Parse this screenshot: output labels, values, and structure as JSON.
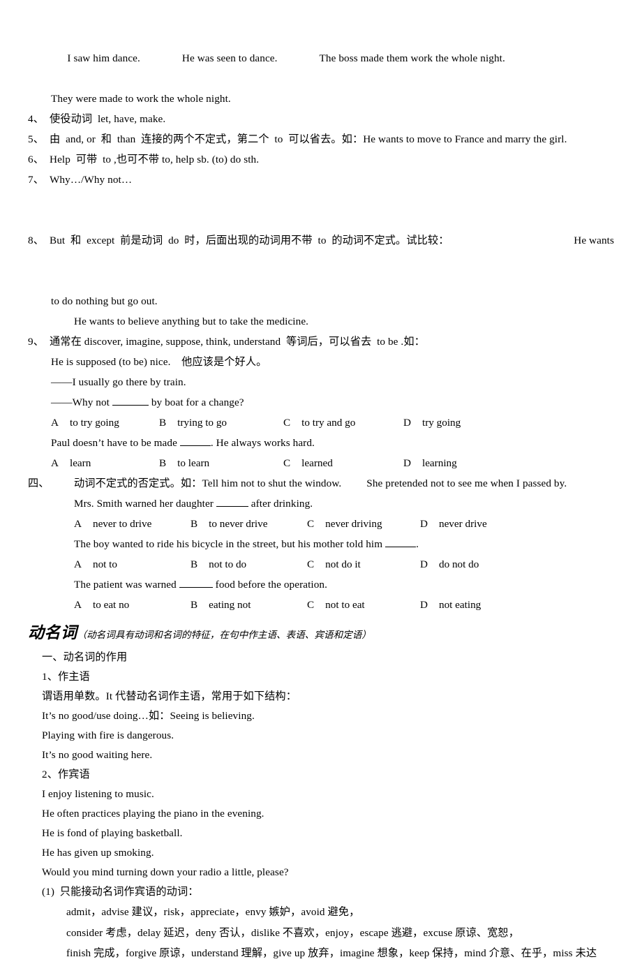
{
  "document": {
    "section_infinitive": {
      "examples_top": {
        "line1_a": "I saw him dance.",
        "line1_b": "He was seen to dance.",
        "line1_c": "The boss made them work the whole night.",
        "line2": "They were made to work the whole night."
      },
      "items": [
        {
          "num": "4、",
          "text": "使役动词  let, have, make."
        },
        {
          "num": "5、",
          "text": "由  and, or  和  than  连接的两个不定式，第二个  to  可以省去。如：He wants to move to France and marry the girl."
        },
        {
          "num": "6、",
          "text": "Help  可带  to ,也可不带 to, help sb. (to) do sth."
        },
        {
          "num": "7、",
          "text": "Why…/Why not…"
        },
        {
          "num": "8、",
          "text": "But  和  except  前是动词  do  时，后面出现的动词用不带  to  的动词不定式。试比较：",
          "tail": "He wants",
          "cont1": "to do nothing but go out.",
          "cont2": "He wants to believe anything but to take the medicine."
        },
        {
          "num": "9、",
          "text": "通常在 discover, imagine, suppose, think, understand  等词后，可以省去  to be .如：",
          "cont1": "He is supposed (to be) nice.    他应该是个好人。"
        }
      ],
      "dialogue": {
        "line_a": "——I usually go there by train.",
        "line_b_pre": "——Why not",
        "line_b_post": "by boat for a change?"
      },
      "question1_options": [
        {
          "letter": "A",
          "text": "to try going"
        },
        {
          "letter": "B",
          "text": "trying to go"
        },
        {
          "letter": "C",
          "text": "to try and go"
        },
        {
          "letter": "D",
          "text": "try going"
        }
      ],
      "question2_stem_pre": "Paul doesn’t have to be made",
      "question2_stem_post": ". He always works hard.",
      "question2_options": [
        {
          "letter": "A",
          "text": "learn"
        },
        {
          "letter": "B",
          "text": "to learn"
        },
        {
          "letter": "C",
          "text": "learned"
        },
        {
          "letter": "D",
          "text": "learning"
        }
      ]
    },
    "section_four": {
      "num": "四、",
      "title": "动词不定式的否定式。如：Tell him not to shut the window.",
      "title_extra": "She pretended not to see me when I passed by.",
      "q1_pre": "Mrs. Smith warned her daughter",
      "q1_post": "after drinking.",
      "q1_options": [
        {
          "letter": "A",
          "text": "never to drive"
        },
        {
          "letter": "B",
          "text": "to never drive"
        },
        {
          "letter": "C",
          "text": "never driving"
        },
        {
          "letter": "D",
          "text": "never drive"
        }
      ],
      "q2_pre": "The boy wanted to ride his bicycle in the street, but his mother told him",
      "q2_post": ".",
      "q2_options": [
        {
          "letter": "A",
          "text": "not to"
        },
        {
          "letter": "B",
          "text": "not to do"
        },
        {
          "letter": "C",
          "text": "not do it"
        },
        {
          "letter": "D",
          "text": "do not do"
        }
      ],
      "q3_pre": "The patient was warned",
      "q3_post": "food before the operation.",
      "q3_options": [
        {
          "letter": "A",
          "text": "to eat no"
        },
        {
          "letter": "B",
          "text": "eating not"
        },
        {
          "letter": "C",
          "text": "not to eat"
        },
        {
          "letter": "D",
          "text": "not eating"
        }
      ]
    },
    "section_gerund": {
      "heading_main": "动名词",
      "heading_paren": "（动名词具有动词和名词的特征，在句中作主语、表语、宾语和定语）",
      "sub1": "一、动名词的作用",
      "sub1_1": "1、作主语",
      "lines_subject": [
        "谓语用单数。It 代替动名词作主语，常用于如下结构：",
        "It’s no good/use doing…如：Seeing is believing.",
        "Playing with fire is dangerous.",
        "It’s no good waiting here."
      ],
      "sub1_2": "2、作宾语",
      "lines_object": [
        "I enjoy listening to music.",
        "He often practices playing the piano in the evening.",
        "He is fond of playing basketball.",
        "He has given up smoking.",
        "Would you mind turning down your radio a little, please?"
      ],
      "list_label": "(1)  只能接动名词作宾语的动词：",
      "vocab_lines": [
        "admit，advise 建议，risk，appreciate，envy 嫉妒，avoid 避免，",
        "consider 考虑，delay 延迟，deny 否认，dislike 不喜欢，enjoy，escape 逃避，excuse 原谅、宽恕，",
        "finish 完成，forgive 原谅，understand 理解，give up 放弃，imagine 想象，keep 保持，mind 介意、在乎，miss 未达"
      ]
    }
  }
}
